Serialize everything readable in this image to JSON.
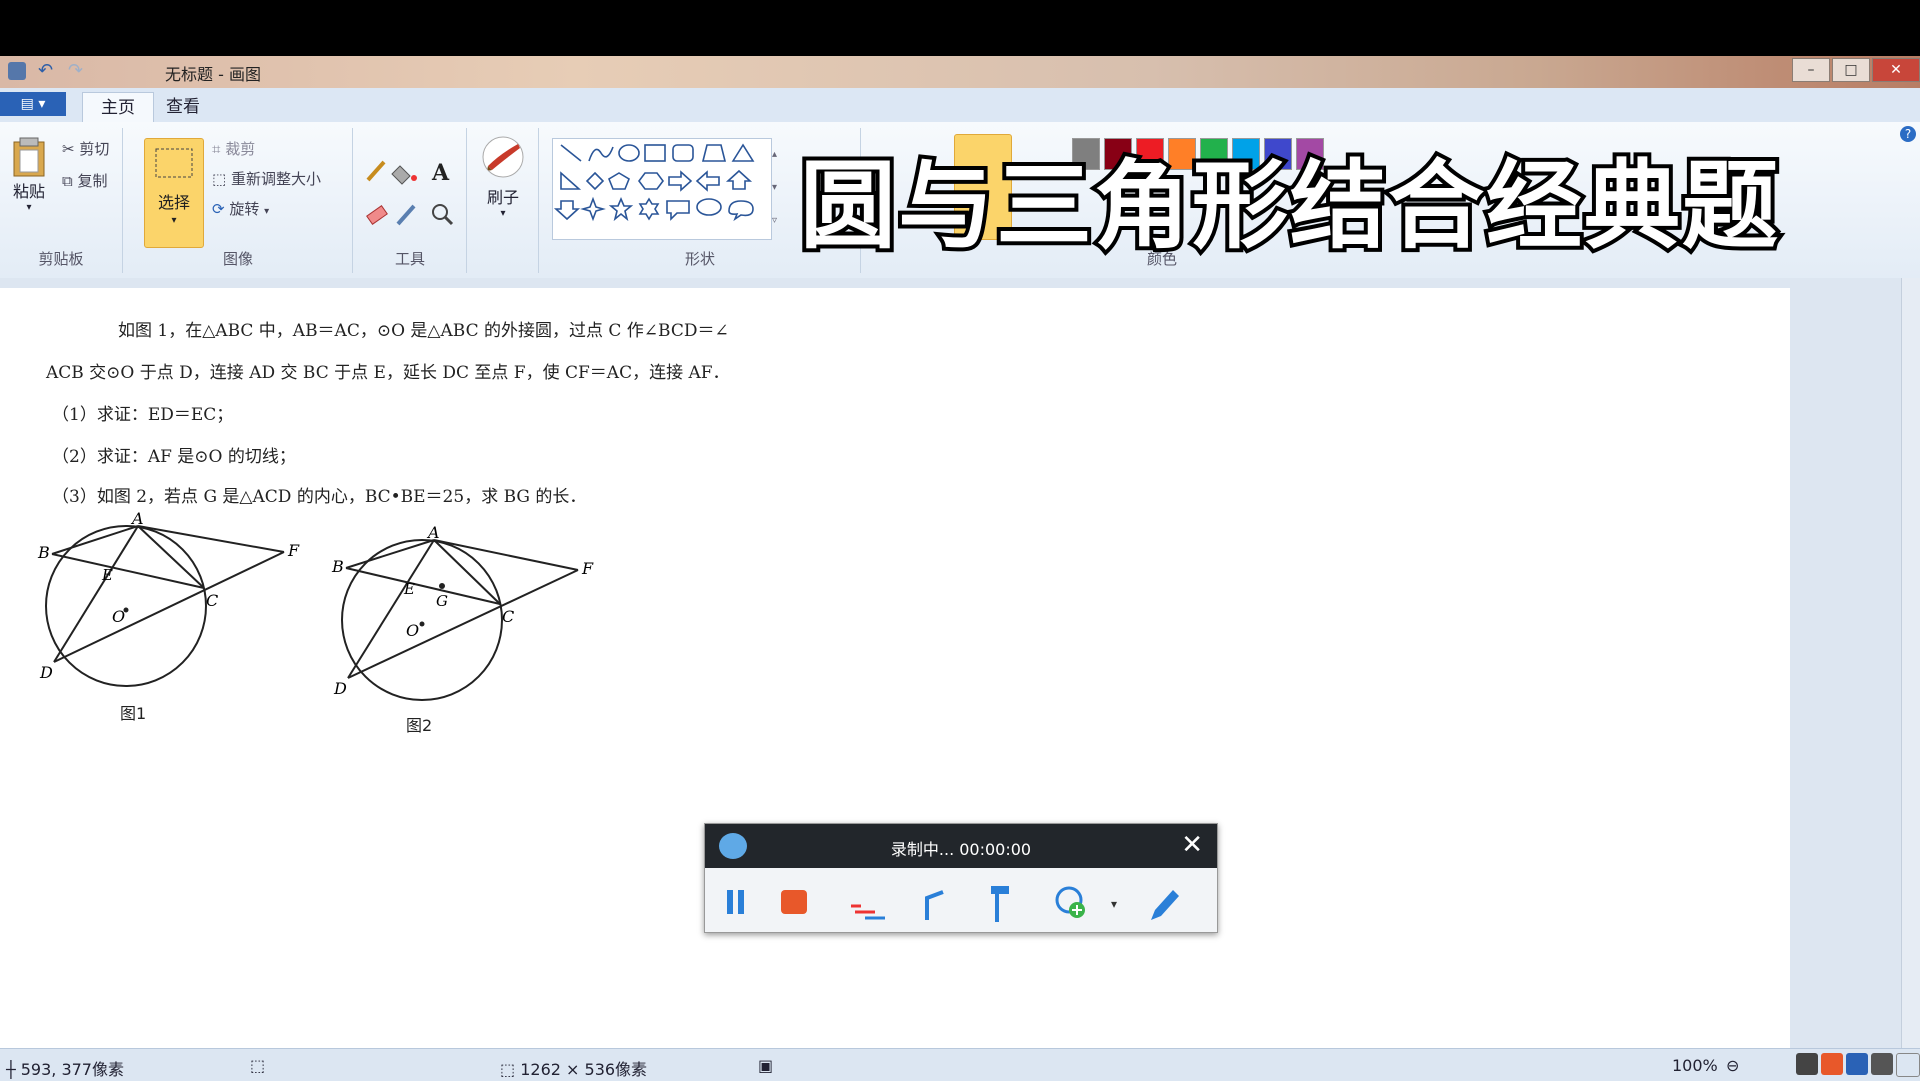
{
  "window": {
    "title": "无标题 - 画图",
    "min": "–",
    "max": "□",
    "close": "✕"
  },
  "tabs": [
    "主页",
    "查看"
  ],
  "app_menu": "▤ ▾",
  "ribbon": {
    "clipboard": {
      "paste": "粘贴",
      "cut": "剪切",
      "copy": "复制",
      "label": "剪贴板"
    },
    "image": {
      "select": "选择",
      "crop": "裁剪",
      "resize": "重新调整大小",
      "rotate": "旋转",
      "label": "图像"
    },
    "tools": {
      "label": "工具"
    },
    "brush": {
      "label": "刷子"
    },
    "shapes": {
      "label": "形状"
    },
    "colors": {
      "label": "颜色",
      "swatches": [
        "#7f7f7f",
        "#880015",
        "#ed1c24",
        "#ff7f27",
        "#22b14c",
        "#00a2e8",
        "#3f48cc",
        "#a349a4"
      ]
    }
  },
  "overlay_title": "圆与三角形结合经典题",
  "problem": {
    "line1": "如图 1，在△ABC 中，AB＝AC，⊙O 是△ABC 的外接圆，过点 C 作∠BCD＝∠",
    "line2": "ACB 交⊙O 于点 D，连接 AD 交 BC 于点 E，延长 DC 至点 F，使 CF＝AC，连接 AF．",
    "q1": "（1）求证：ED＝EC；",
    "q2": "（2）求证：AF 是⊙O 的切线；",
    "q3": "（3）如图 2，若点 G 是△ACD 的内心，BC•BE＝25，求 BG 的长．",
    "fig1_caption": "图1",
    "fig2_caption": "图2",
    "fig_labels": {
      "A": "A",
      "B": "B",
      "C": "C",
      "D": "D",
      "E": "E",
      "F": "F",
      "O": "O",
      "G": "G"
    }
  },
  "recorder": {
    "status": "录制中... 00:00:00",
    "close": "✕"
  },
  "statusbar": {
    "cursor": "593, 377像素",
    "size": "1262 × 536像素",
    "zoom": "100%"
  }
}
